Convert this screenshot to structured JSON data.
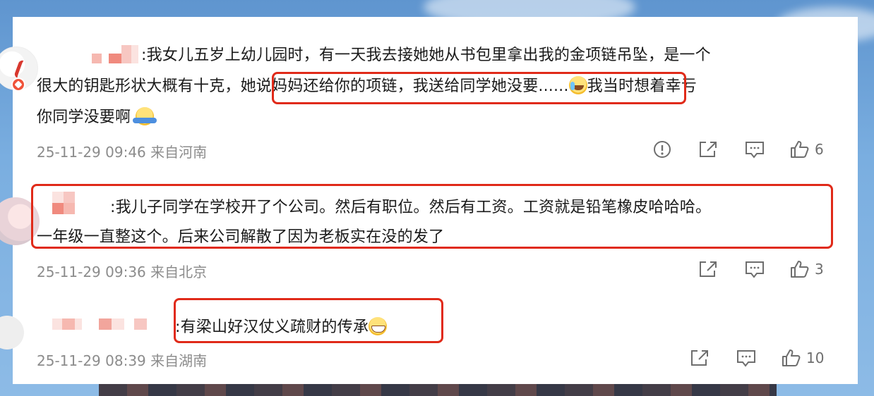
{
  "comments": [
    {
      "prefix": ":我女儿五岁上幼儿园时，有一天我去接她她从书包里拿出我的金项链吊坠，是一个",
      "line2_pre": "很大的钥匙形状大概有十克，",
      "line2_highlight": "她说妈妈还给你的项链，我送给同学她没要......",
      "line2_post": "我当时想着幸亏",
      "line3": "你同学没要啊",
      "timestamp": "25-11-29 09:46 来自河南",
      "likes": "6"
    },
    {
      "line1": ":我儿子同学在学校开了个公司。然后有职位。然后有工资。工资就是铅笔橡皮哈哈哈。",
      "line2": "一年级一直整这个。后来公司解散了因为老板实在没的发了",
      "timestamp": "25-11-29 09:36 来自北京",
      "likes": "3"
    },
    {
      "line1": ":有梁山好汉仗义疏财的传承",
      "timestamp": "25-11-29 08:39 来自湖南",
      "likes": "10"
    }
  ],
  "icons": {
    "report": "report-icon",
    "share": "share-icon",
    "reply": "comment-icon",
    "like": "thumbs-up-icon"
  },
  "colors": {
    "highlight": "#e02a19",
    "meta": "#8c8c8c",
    "text": "#1a1a1a"
  }
}
